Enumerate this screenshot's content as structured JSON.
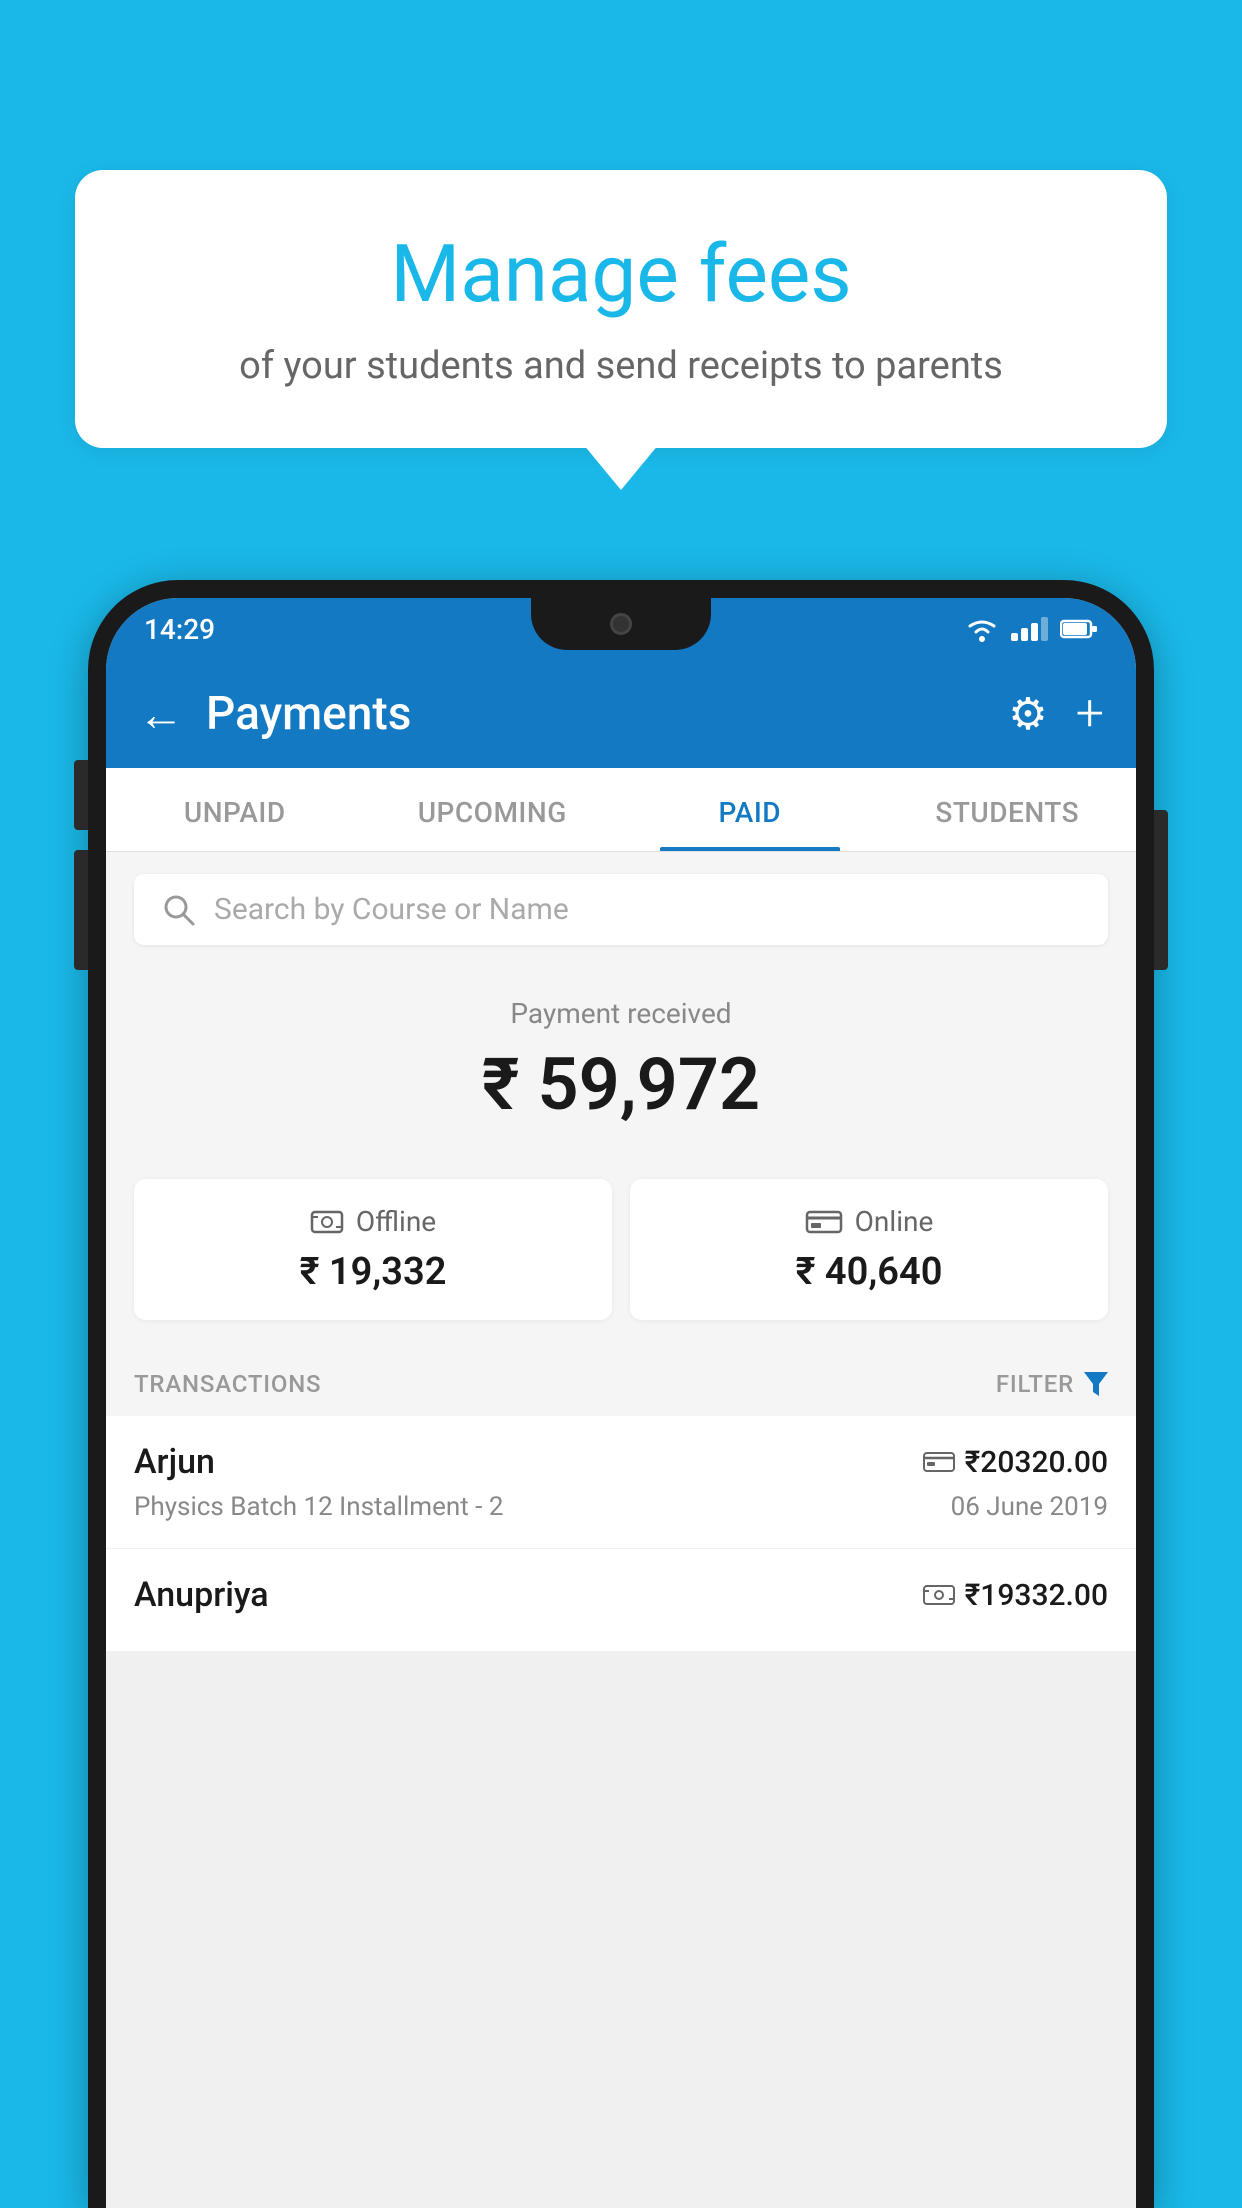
{
  "background_color": "#1ab8e8",
  "bubble": {
    "title": "Manage fees",
    "subtitle": "of your students and send receipts to parents"
  },
  "status_bar": {
    "time": "14:29",
    "wifi": "▾",
    "battery": "▮"
  },
  "header": {
    "title": "Payments",
    "back_label": "←",
    "gear_label": "⚙",
    "plus_label": "+"
  },
  "tabs": [
    {
      "id": "unpaid",
      "label": "UNPAID",
      "active": false
    },
    {
      "id": "upcoming",
      "label": "UPCOMING",
      "active": false
    },
    {
      "id": "paid",
      "label": "PAID",
      "active": true
    },
    {
      "id": "students",
      "label": "STUDENTS",
      "active": false
    }
  ],
  "search": {
    "placeholder": "Search by Course or Name"
  },
  "payment_received": {
    "label": "Payment received",
    "amount": "₹ 59,972",
    "offline_label": "Offline",
    "offline_amount": "₹ 19,332",
    "online_label": "Online",
    "online_amount": "₹ 40,640"
  },
  "transactions": {
    "header_label": "TRANSACTIONS",
    "filter_label": "FILTER",
    "items": [
      {
        "name": "Arjun",
        "amount": "₹20320.00",
        "course": "Physics Batch 12 Installment - 2",
        "date": "06 June 2019",
        "icon": "card"
      },
      {
        "name": "Anupriya",
        "amount": "₹19332.00",
        "course": "",
        "date": "",
        "icon": "cash"
      }
    ]
  }
}
